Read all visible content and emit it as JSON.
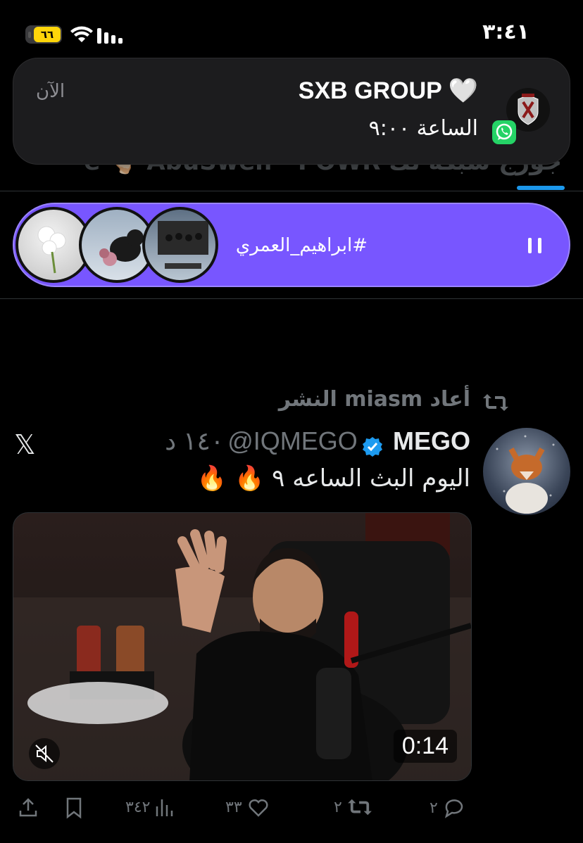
{
  "status_bar": {
    "time": "٣:٤١",
    "battery": "٦٦"
  },
  "tabs_row": {
    "visible_text": "e 🫰🏻 AbuSwen · POWR جورج   شبكة  لك"
  },
  "notification": {
    "app_name": "SXB GROUP",
    "title_emoji": "🤍",
    "body": "الساعة ٩:٠٠",
    "time": "الآن"
  },
  "space": {
    "title": "#ابراهيم_العمري"
  },
  "tweet": {
    "retweeted_by": "أعاد miasm النشر",
    "name": "MEGO",
    "handle": "@IQMEGO",
    "age": "١٤٠ د",
    "text": "اليوم البث الساعه ٩",
    "emojis": "🔥 🔥",
    "video_duration": "0:14",
    "replies": "٢",
    "retweets": "٢",
    "likes": "٣٣",
    "views": "٣٤٢"
  },
  "colors": {
    "accent": "#1d9bf0",
    "space": "#7856ff",
    "whatsapp": "#25d366",
    "battery": "#ffd60a"
  },
  "icons": [
    "wifi-icon",
    "signal-icon",
    "battery-icon",
    "whatsapp-icon",
    "pause-icon",
    "retweet-icon",
    "verified-icon",
    "x-logo-icon",
    "mute-icon",
    "reply-icon",
    "like-icon",
    "views-icon",
    "bookmark-icon",
    "share-icon"
  ]
}
